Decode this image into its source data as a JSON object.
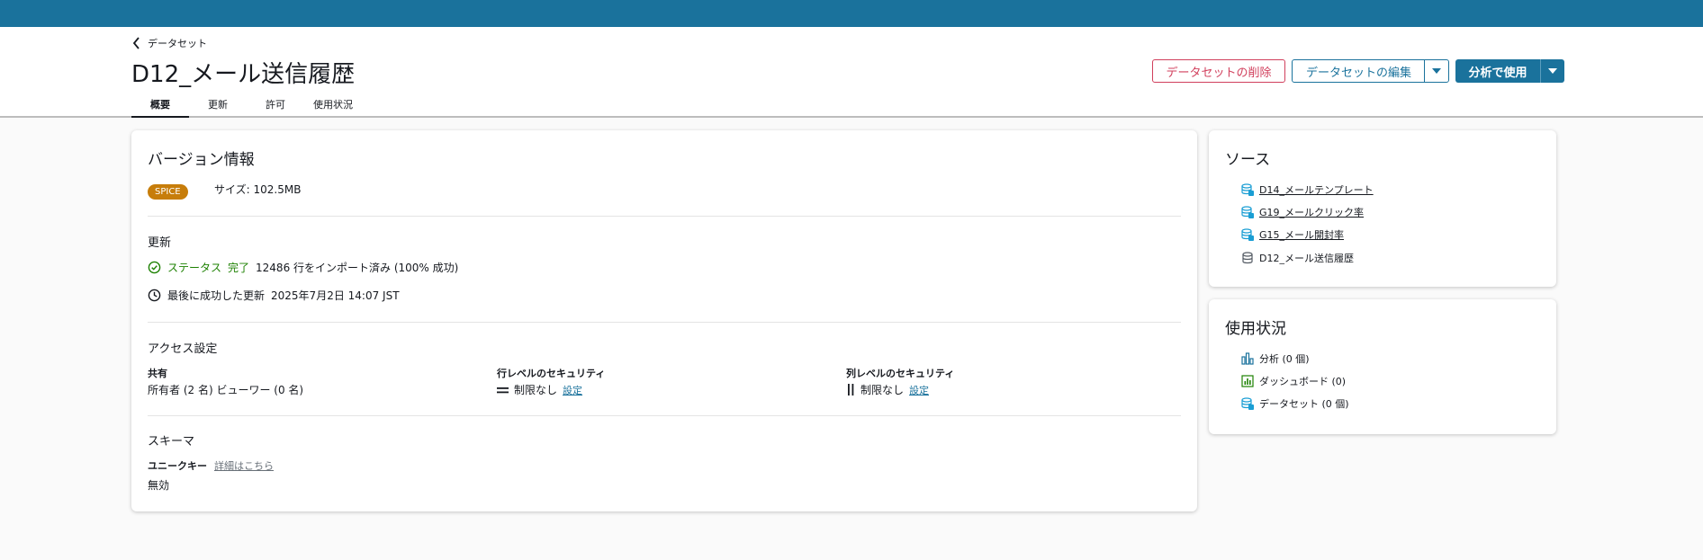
{
  "header": {
    "back_label": "データセット",
    "title": "D12_メール送信履歴",
    "tabs": [
      {
        "label": "概要",
        "active": true
      },
      {
        "label": "更新",
        "active": false
      },
      {
        "label": "許可",
        "active": false
      },
      {
        "label": "使用状況",
        "active": false
      }
    ],
    "delete_button": "データセットの削除",
    "edit_button": "データセットの編集",
    "use_button": "分析で使用"
  },
  "version": {
    "heading": "バージョン情報",
    "badge": "SPICE",
    "size_label": "サイズ: 102.5MB"
  },
  "refresh": {
    "heading": "更新",
    "status_label": "ステータス",
    "status_value": "完了",
    "status_detail": "12486 行をインポート済み (100% 成功)",
    "last_label": "最後に成功した更新",
    "last_value": "2025年7月2日 14:07 JST"
  },
  "access": {
    "heading": "アクセス設定",
    "share_label": "共有",
    "share_value": "所有者 (2 名)  ビューワー (0 名)",
    "row_security_label": "行レベルのセキュリティ",
    "row_security_value": "制限なし",
    "row_security_link": "設定",
    "col_security_label": "列レベルのセキュリティ",
    "col_security_value": "制限なし",
    "col_security_link": "設定"
  },
  "schema": {
    "heading": "スキーマ",
    "unique_key_label": "ユニークキー",
    "details_link": "詳細はこちら",
    "unique_key_value": "無効"
  },
  "source": {
    "heading": "ソース",
    "items": [
      {
        "label": "D14_メールテンプレート",
        "icon": "dataset-link-icon",
        "link": true
      },
      {
        "label": "G19_メールクリック率",
        "icon": "dataset-link-icon",
        "link": true
      },
      {
        "label": "G15_メール開封率",
        "icon": "dataset-link-icon",
        "link": true
      },
      {
        "label": "D12_メール送信履歴",
        "icon": "database-icon",
        "link": false
      }
    ]
  },
  "usage": {
    "heading": "使用状況",
    "items": [
      {
        "label": "分析 (0 個)",
        "icon": "analysis-icon"
      },
      {
        "label": "ダッシュボード (0)",
        "icon": "dashboard-icon"
      },
      {
        "label": "データセット (0 個)",
        "icon": "dataset-icon"
      }
    ]
  },
  "colors": {
    "topbar": "#1a729c",
    "primary": "#1a729c",
    "danger": "#d13f5c",
    "success": "#1d8102",
    "spice_badge": "#c77d0a"
  }
}
